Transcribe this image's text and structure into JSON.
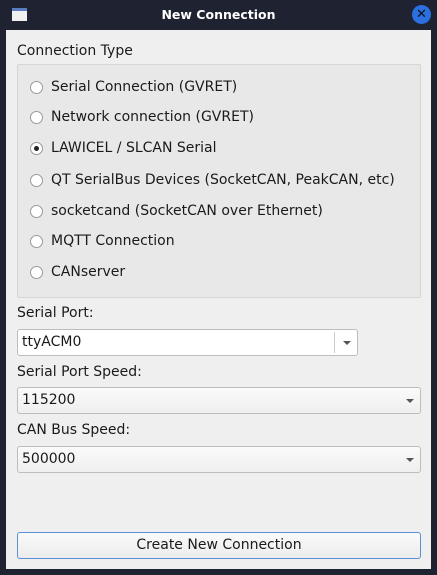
{
  "window": {
    "title": "New Connection"
  },
  "connection_type": {
    "label": "Connection Type",
    "options": [
      {
        "label": "Serial Connection (GVRET)",
        "selected": false
      },
      {
        "label": "Network connection (GVRET)",
        "selected": false
      },
      {
        "label": "LAWICEL / SLCAN Serial",
        "selected": true
      },
      {
        "label": "QT SerialBus Devices (SocketCAN, PeakCAN, etc)",
        "selected": false
      },
      {
        "label": "socketcand (SocketCAN over Ethernet)",
        "selected": false
      },
      {
        "label": "MQTT Connection",
        "selected": false
      },
      {
        "label": "CANserver",
        "selected": false
      }
    ]
  },
  "serial_port": {
    "label": "Serial Port:",
    "value": "ttyACM0"
  },
  "serial_speed": {
    "label": "Serial Port Speed:",
    "value": "115200"
  },
  "can_speed": {
    "label": "CAN Bus Speed:",
    "value": "500000"
  },
  "create_button": "Create New Connection"
}
